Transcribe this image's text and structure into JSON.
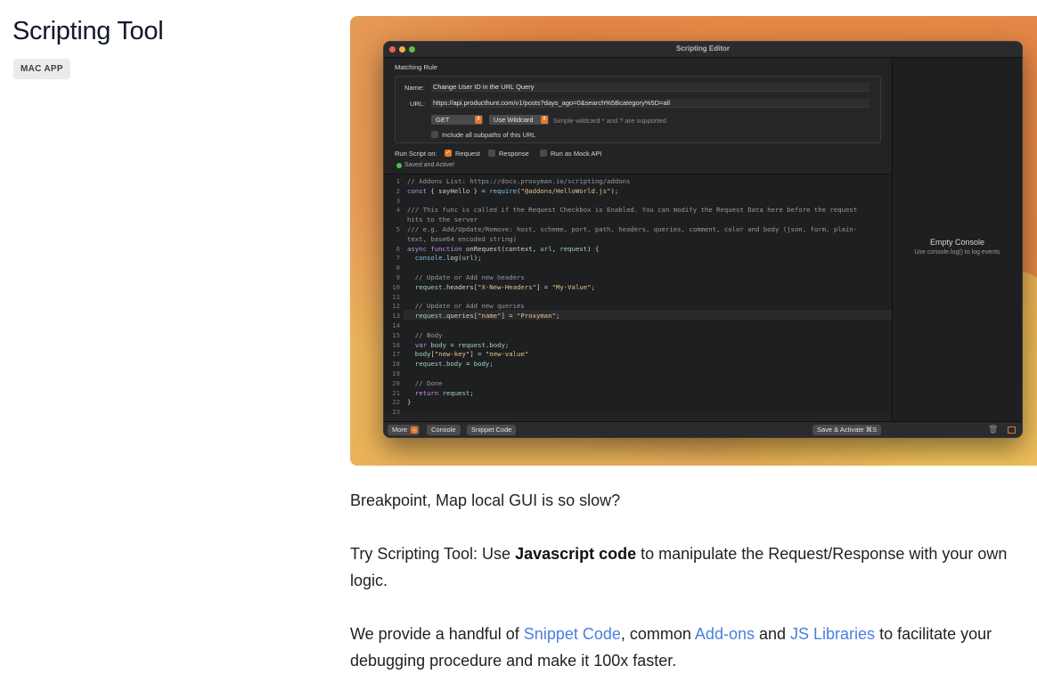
{
  "page": {
    "title": "Scripting Tool",
    "badge": "MAC APP"
  },
  "window": {
    "title": "Scripting Editor",
    "traffic_lights": [
      "#ec5f57",
      "#e6b53c",
      "#5fc043"
    ],
    "matching_rule_label": "Matching Rule",
    "name_label": "Name:",
    "name_value": "Change User ID in the URL Query",
    "url_label": "URL:",
    "url_value": "https://api.producthunt.com/v1/posts?days_ago=0&search%5Bcategory%5D=all",
    "method": "GET",
    "match_type": "Use Wildcard",
    "wildcard_hint": "Simple wildcard * and ? are supported",
    "subpaths_label": "Include all subpaths of this URL",
    "subpaths_checked": false,
    "run_script_label": "Run Script on:",
    "request_label": "Request",
    "request_checked": true,
    "response_label": "Response",
    "response_checked": false,
    "mock_label": "Run as Mock API",
    "mock_checked": false,
    "status": "Saved and Active!",
    "status_color": "#4cc14a",
    "code_lines": [
      {
        "n": "1",
        "t": "// Addons List: https://docs.proxyman.io/scripting/addons"
      },
      {
        "n": "2",
        "t": "const { sayHello } = require(\"@addons/HelloWorld.js\");"
      },
      {
        "n": "3",
        "t": ""
      },
      {
        "n": "4",
        "t": "/// This func is called if the Request Checkbox is Enabled. You can modify the Request Data here before the request"
      },
      {
        "n": "",
        "t": "hits to the server"
      },
      {
        "n": "5",
        "t": "/// e.g. Add/Update/Remove: host, scheme, port, path, headers, queries, comment, color and body (json, form, plain-"
      },
      {
        "n": "",
        "t": "text, base64 encoded string)"
      },
      {
        "n": "6",
        "t": "async function onRequest(context, url, request) {"
      },
      {
        "n": "7",
        "t": "  console.log(url);"
      },
      {
        "n": "8",
        "t": ""
      },
      {
        "n": "9",
        "t": "  // Update or Add new headers"
      },
      {
        "n": "10",
        "t": "  request.headers[\"X-New-Headers\"] = \"My-Value\";"
      },
      {
        "n": "11",
        "t": ""
      },
      {
        "n": "12",
        "t": "  // Update or Add new queries"
      },
      {
        "n": "13",
        "t": "  request.queries[\"name\"] = \"Proxyman\";"
      },
      {
        "n": "14",
        "t": ""
      },
      {
        "n": "15",
        "t": "  // Body"
      },
      {
        "n": "16",
        "t": "  var body = request.body;"
      },
      {
        "n": "17",
        "t": "  body[\"new-key\"] = \"new-value\""
      },
      {
        "n": "18",
        "t": "  request.body = body;"
      },
      {
        "n": "19",
        "t": ""
      },
      {
        "n": "20",
        "t": "  // Done"
      },
      {
        "n": "21",
        "t": "  return request;"
      },
      {
        "n": "22",
        "t": "}"
      },
      {
        "n": "23",
        "t": ""
      }
    ],
    "more_label": "More",
    "console_label": "Console",
    "snippet_label": "Snippet Code",
    "save_label": "Save & Activate ⌘S",
    "console_empty_title": "Empty Console",
    "console_empty_hint": "Use console.log() to log events"
  },
  "body": {
    "p1": "Breakpoint, Map local GUI is so slow?",
    "p2_pre": "Try Scripting Tool: Use ",
    "p2_bold": "Javascript code",
    "p2_post": " to manipulate the Request/Response with your own logic.",
    "p3_pre": "We provide a handful of ",
    "p3_link1": "Snippet Code",
    "p3_mid1": ", common ",
    "p3_link2": "Add-ons",
    "p3_mid2": " and ",
    "p3_link3": "JS Libraries",
    "p3_post": " to facilitate your debugging procedure and make it 100x faster.",
    "link_color": "#4a7fe0"
  }
}
